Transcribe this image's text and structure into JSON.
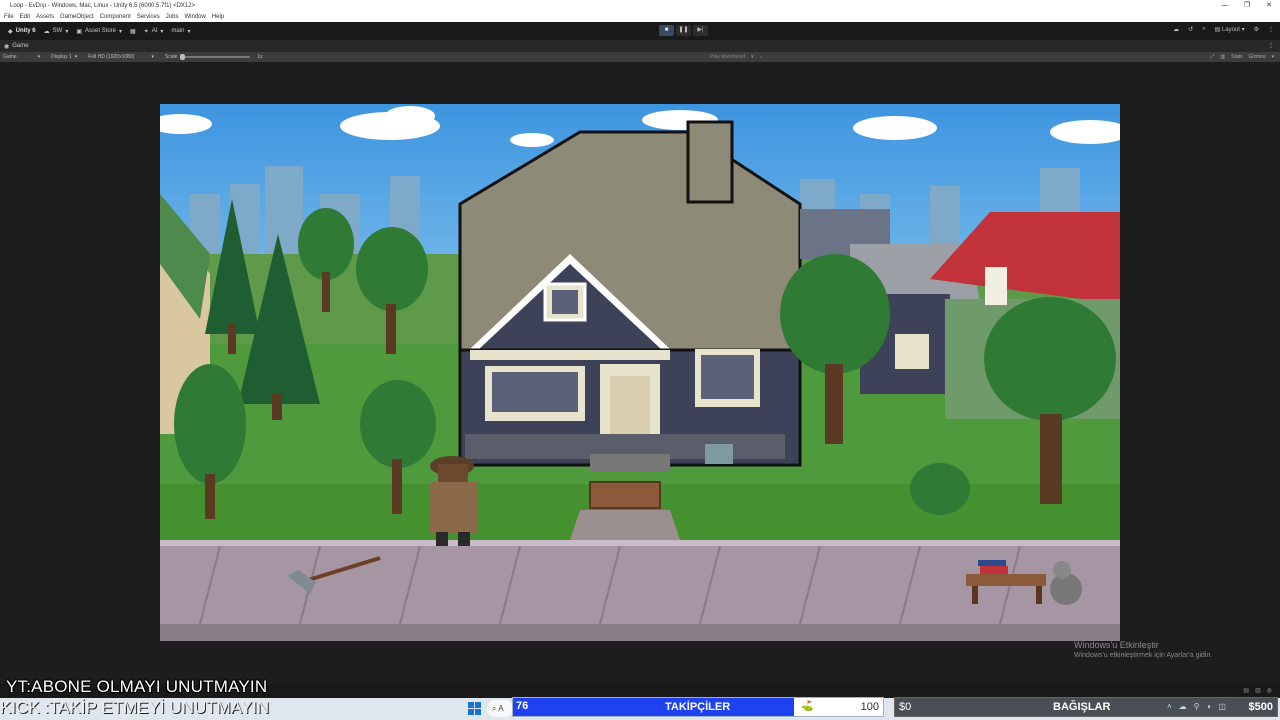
{
  "window": {
    "title": "Loop - EvDışı - Windows, Mac, Linux - Unity 6.5 (6000.5.7f1) <DX12>",
    "controls": [
      "—",
      "❐",
      "✕"
    ]
  },
  "menu": [
    "File",
    "Edit",
    "Assets",
    "GameObject",
    "Component",
    "Services",
    "Jobs",
    "Window",
    "Help"
  ],
  "toolbar": {
    "unity_label": "Unity 6",
    "account": "SW",
    "asset_store": "Asset Store",
    "ai": "AI",
    "branch": "main",
    "layout": "Layout"
  },
  "tab": {
    "label": "Game"
  },
  "gamebar": {
    "mode": "Game",
    "display": "Display 1",
    "resolution": "Full HD (1920x1080)",
    "scale_label": "Scale",
    "scale_value": "1x",
    "play_focused": "Play Maximized",
    "stats": "Stats",
    "gizmos": "Gizmos"
  },
  "watermark": {
    "line1": "Windows'u Etkinleştir",
    "line2": "Windows'u etkinleştirmek için Ayarlar'a gidin."
  },
  "overlay": {
    "line1": "YT:ABONE OLMAYI UNUTMAYIN",
    "line2": "KICK :TAKİP ETMEYİ UNUTMAYIN"
  },
  "taskbar": {
    "search_text": "A",
    "followers": {
      "current": "76",
      "label": "TAKİPÇİLER",
      "goal": "100",
      "progress": 0.76
    },
    "donations": {
      "current": "$0",
      "label": "BAĞIŞLAR",
      "goal": "$500"
    }
  },
  "colors": {
    "follower_fill": "#1e42f0",
    "donation_bg": "#4a4f55",
    "sky": "#4aa3e6"
  }
}
